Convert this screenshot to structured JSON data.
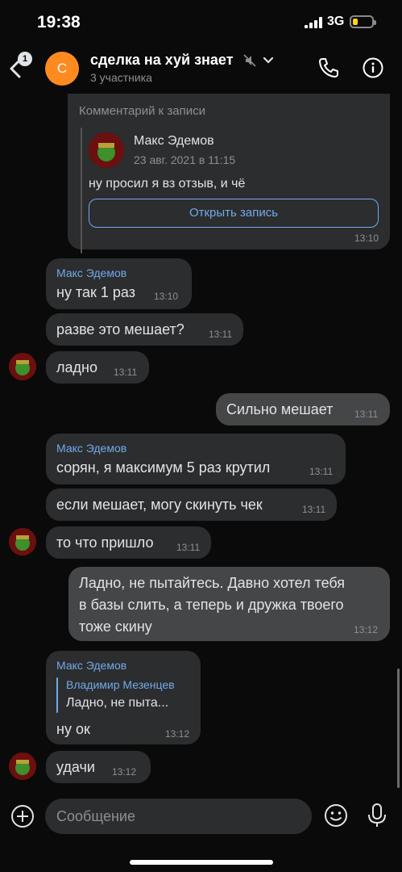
{
  "status_bar": {
    "time": "19:38",
    "network": "3G"
  },
  "header": {
    "back_badge": "1",
    "avatar_letter": "С",
    "title": "сделка на хуй знает",
    "subtitle": "3 участника",
    "icons": [
      "back-arrow-icon",
      "muted-icon",
      "chevron-down-icon",
      "phone-icon",
      "info-icon"
    ]
  },
  "post_card": {
    "title": "Комментарий к записи",
    "author": "Макс Эдемов",
    "date": "23 авг. 2021 в 11:15",
    "text": "ну просил я вз отзыв, и чё",
    "button": "Открыть запись",
    "time": "13:10"
  },
  "messages": [
    {
      "direction": "in",
      "sender": "Макс Эдемов",
      "text": "ну так 1 раз",
      "time": "13:10"
    },
    {
      "direction": "in",
      "text": "разве это мешает?",
      "time": "13:11"
    },
    {
      "direction": "in",
      "text": "ладно",
      "time": "13:11"
    },
    {
      "direction": "out",
      "text": "Сильно мешает",
      "time": "13:11"
    },
    {
      "direction": "in",
      "sender": "Макс Эдемов",
      "text": "сорян, я максимум 5 раз крутил",
      "time": "13:11"
    },
    {
      "direction": "in",
      "text": "если мешает, могу скинуть чек",
      "time": "13:11"
    },
    {
      "direction": "in",
      "text": "то что пришло",
      "time": "13:11"
    },
    {
      "direction": "out",
      "lines": [
        "Ладно, не пытайтесь. Давно хотел тебя",
        "в базы слить, а теперь и дружка твоего",
        "тоже скину"
      ],
      "time": "13:12"
    },
    {
      "direction": "in",
      "sender": "Макс Эдемов",
      "reply_author": "Владимир Мезенцев",
      "reply_text": "Ладно, не пыта...",
      "text": "ну ок",
      "time": "13:12"
    },
    {
      "direction": "in",
      "text": "удачи",
      "time": "13:12"
    }
  ],
  "composer": {
    "placeholder": "Сообщение"
  },
  "colors": {
    "background": "#0a0a0a",
    "incoming": "#2c2d2e",
    "outgoing": "#454647",
    "accent": "#71aaeb",
    "avatar": "#ff8a1f"
  }
}
